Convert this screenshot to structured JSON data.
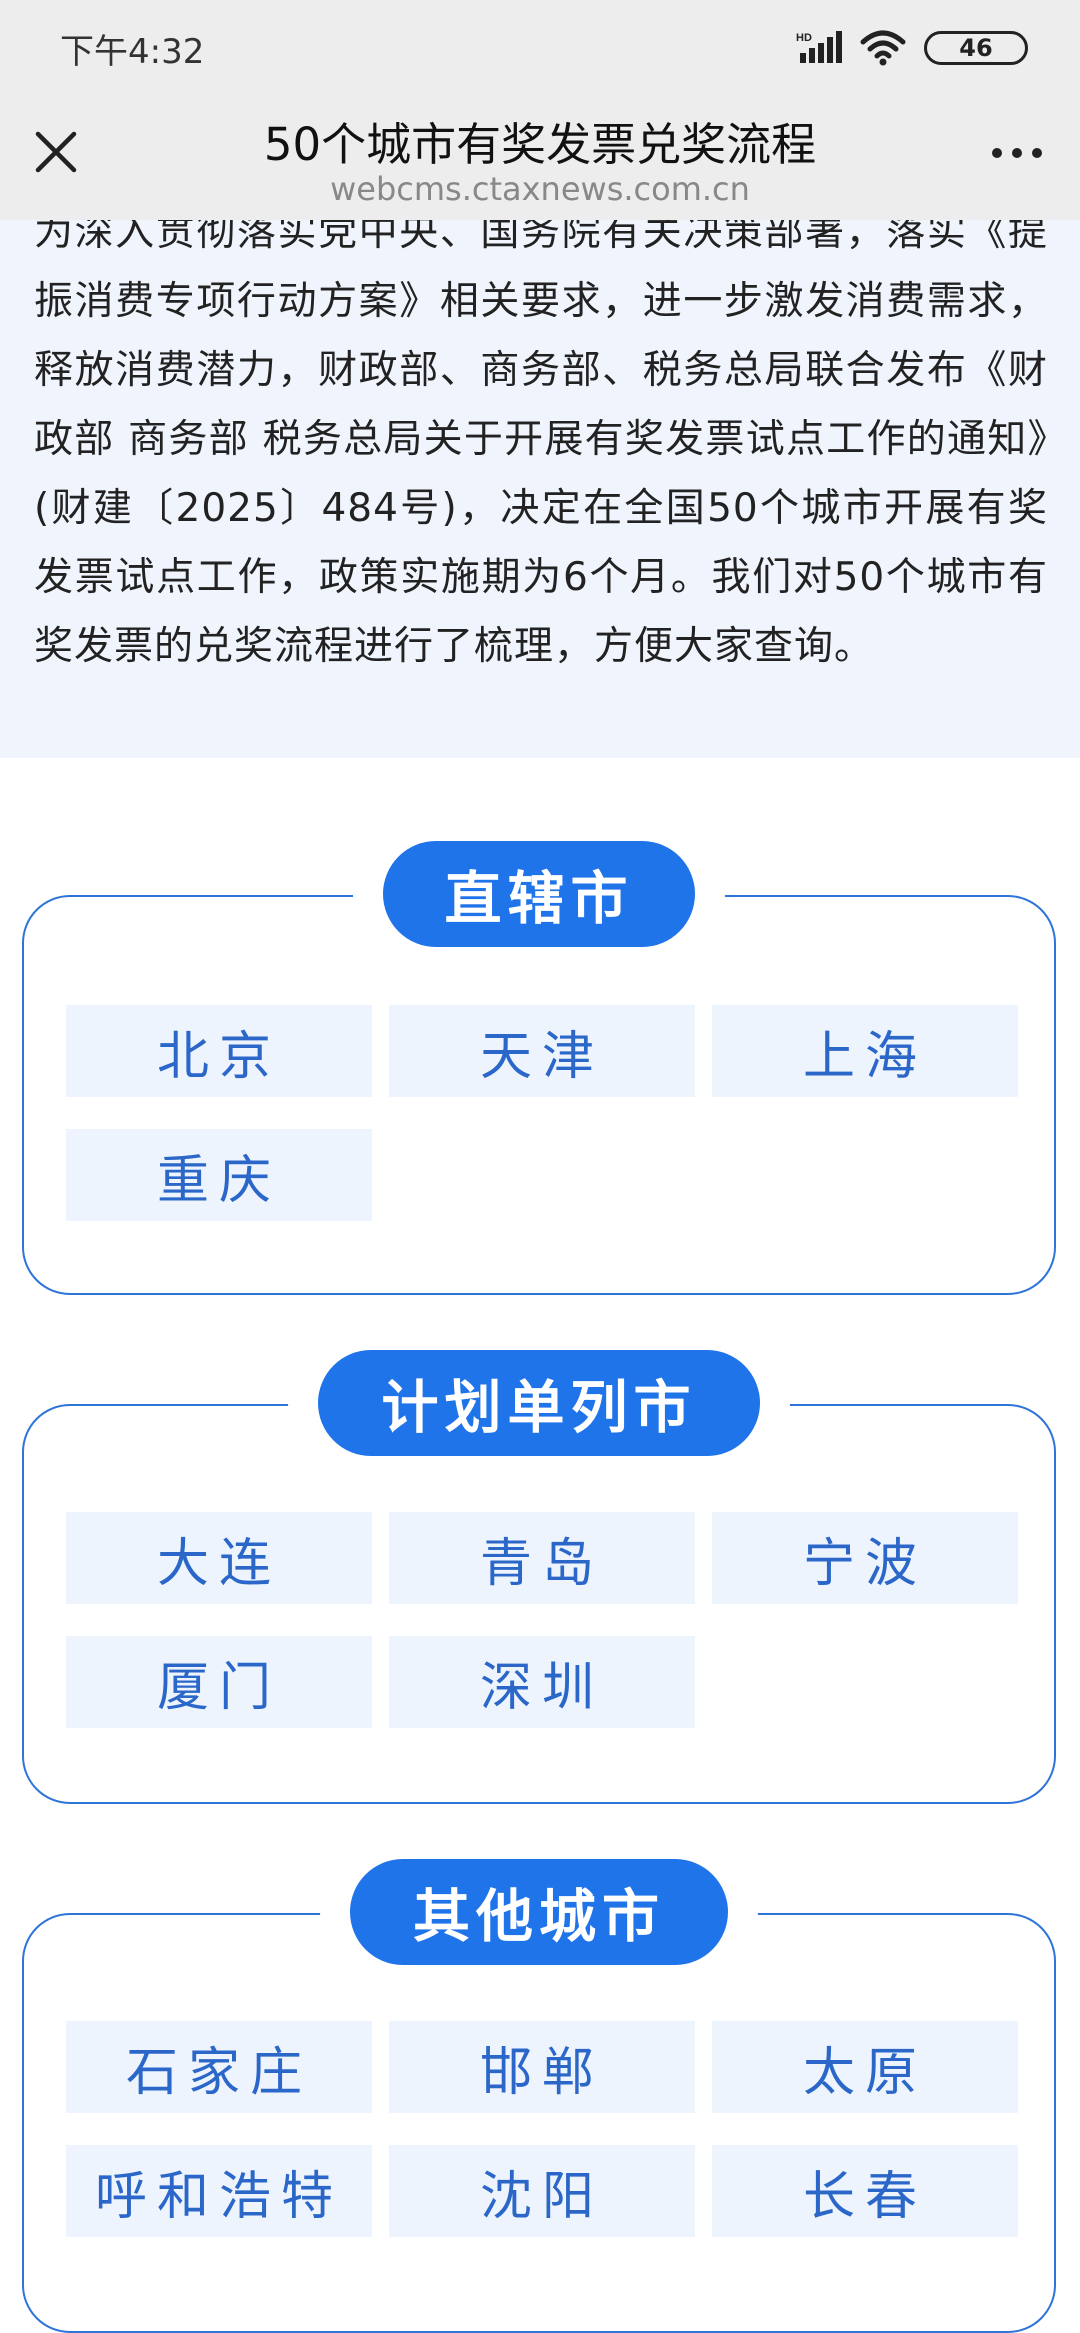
{
  "status": {
    "time": "下午4:32",
    "battery": "46",
    "network": "HD"
  },
  "nav": {
    "title": "50个城市有奖发票兑奖流程",
    "url": "webcms.ctaxnews.com.cn"
  },
  "intro": {
    "text": "为深入贯彻落实党中央、国务院有关决策部署，落实《提振消费专项行动方案》相关要求，进一步激发消费需求，释放消费潜力，财政部、商务部、税务总局联合发布《财政部 商务部 税务总局关于开展有奖发票试点工作的通知》(财建〔2025〕484号)，决定在全国50个城市开展有奖发票试点工作，政策实施期为6个月。我们对50个城市有奖发票的兑奖流程进行了梳理，方便大家查询。"
  },
  "sections": [
    {
      "title": "直辖市",
      "cities": [
        "北京",
        "天津",
        "上海",
        "重庆"
      ]
    },
    {
      "title": "计划单列市",
      "cities": [
        "大连",
        "青岛",
        "宁波",
        "厦门",
        "深圳"
      ]
    },
    {
      "title": "其他城市",
      "cities": [
        "石家庄",
        "邯郸",
        "太原",
        "呼和浩特",
        "沈阳",
        "长春"
      ]
    }
  ]
}
